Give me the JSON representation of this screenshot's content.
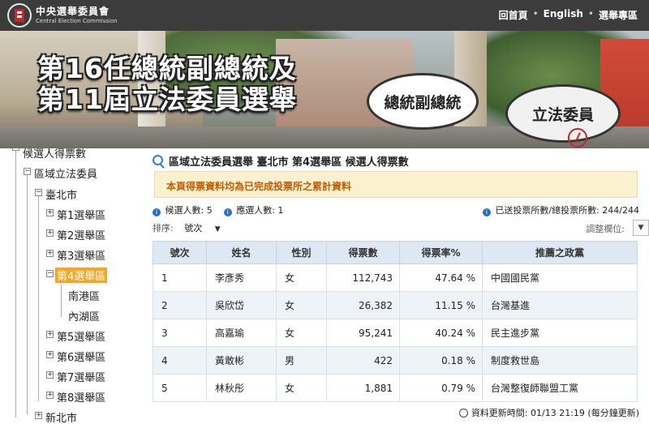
{
  "header": {
    "org_name": "中央選舉委員會",
    "org_sub": "Central Election Commission",
    "nav": [
      "回首頁",
      "English",
      "選舉專區"
    ]
  },
  "banner": {
    "title_line1": "第16任總統副總統及",
    "title_line2": "第11屆立法委員選舉",
    "bubble1": "總統副總統",
    "bubble2": "立法委員"
  },
  "sidebar": {
    "root": "候選人得票數",
    "level1": "區域立法委員",
    "level2": "臺北市",
    "districts": [
      "第1選舉區",
      "第2選舉區",
      "第3選舉區",
      "第4選舉區"
    ],
    "sub_areas": [
      "南港區",
      "內湖區"
    ],
    "more_districts": [
      "第5選舉區",
      "第6選舉區",
      "第7選舉區",
      "第8選舉區"
    ],
    "next_city": "新北市"
  },
  "main": {
    "title": "區域立法委員選舉 臺北市 第4選舉區 候選人得票數",
    "notice": "本頁得票資料均為已完成投票所之累計資料",
    "candidate_count": "候選人數: 5",
    "elected_count": "應選人數: 1",
    "stations": "已送投票所數/總投票所數: 244/244",
    "sort_label": "排序:",
    "sort_value": "號次",
    "adjust_label": "調整欄位:",
    "update_time": "資料更新時間: 01/13 21:19 (每分鐘更新)"
  },
  "table": {
    "headers": [
      "號次",
      "姓名",
      "性別",
      "得票數",
      "得票率%",
      "推薦之政黨"
    ],
    "rows": [
      [
        "1",
        "李彥秀",
        "女",
        "112,743",
        "47.64 %",
        "中國國民黨"
      ],
      [
        "2",
        "吳欣岱",
        "女",
        "26,382",
        "11.15 %",
        "台灣基進"
      ],
      [
        "3",
        "高嘉瑜",
        "女",
        "95,241",
        "40.24 %",
        "民主進步黨"
      ],
      [
        "4",
        "黃敢彬",
        "男",
        "422",
        "0.18 %",
        "制度救世島"
      ],
      [
        "5",
        "林秋彤",
        "女",
        "1,881",
        "0.79 %",
        "台灣整復師聯盟工黨"
      ]
    ]
  }
}
